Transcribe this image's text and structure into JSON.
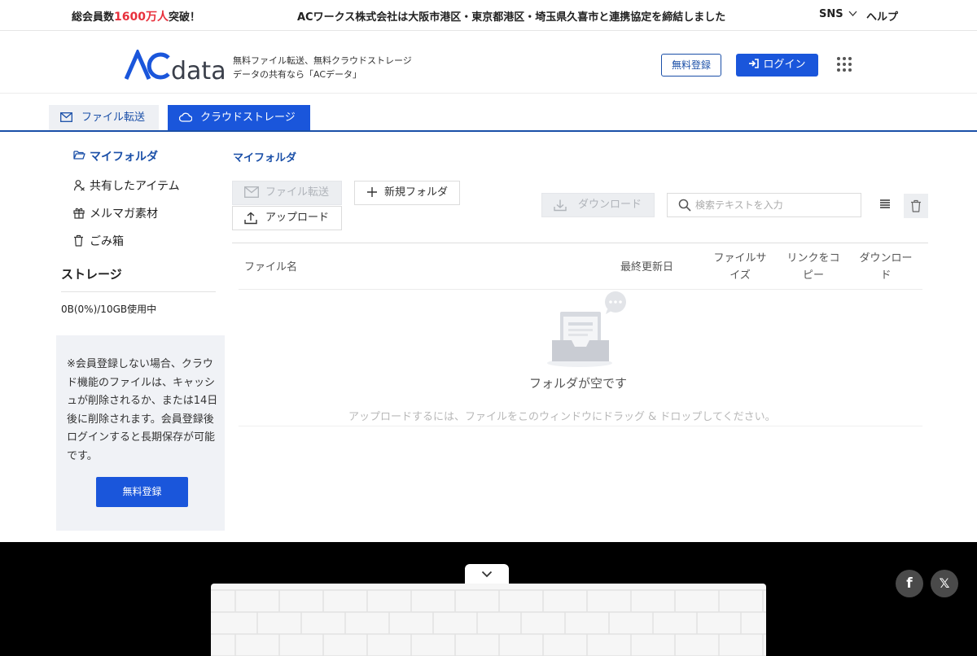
{
  "topbar": {
    "members_prefix": "総会員数",
    "members_count": "1600万人",
    "members_suffix": "突破！",
    "announcement": "ACワークス株式会社は大阪市港区・東京都港区・埼玉県久喜市と連携協定を締結しました",
    "sns_label": "SNS",
    "help_label": "ヘルプ"
  },
  "header": {
    "logo_text": "data",
    "tagline_line1": "無料ファイル転送、無料クラウドストレージ",
    "tagline_line2": "データの共有なら「ACデータ」",
    "register_label": "無料登録",
    "login_label": "ログイン"
  },
  "tabs": {
    "transfer_label": "ファイル転送",
    "cloud_label": "クラウドストレージ"
  },
  "sidebar": {
    "items": [
      {
        "label": "マイフォルダ"
      },
      {
        "label": "共有したアイテム"
      },
      {
        "label": "メルマガ素材"
      },
      {
        "label": "ごみ箱"
      }
    ],
    "storage_title": "ストレージ",
    "storage_usage": "0B(0%)/10GB使用中",
    "notice": "※会員登録しない場合、クラウド機能のファイルは、キャッシュが削除されるか、または14日後に削除されます。会員登録後ログインすると長期保存が可能です。",
    "register_label": "無料登録"
  },
  "main": {
    "breadcrumb": "マイフォルダ",
    "toolbar": {
      "transfer_label": "ファイル転送",
      "upload_label": "アップロード",
      "new_folder_label": "新規フォルダ",
      "download_label": "ダウンロード",
      "search_placeholder": "検索テキストを入力"
    },
    "columns": {
      "name": "ファイル名",
      "date": "最終更新日",
      "size_line1": "ファイルサ",
      "size_line2": "イズ",
      "link_line1": "リンクをコ",
      "link_line2": "ピー",
      "download_line1": "ダウンロー",
      "download_line2": "ド"
    },
    "empty_title": "フォルダが空です",
    "empty_hint": "アップロードするには、ファイルをこのウィンドウにドラッグ & ドロップしてください。"
  },
  "footer": {
    "facebook_label": "f",
    "x_label": "𝕏"
  },
  "colors": {
    "brand": "#1a56db",
    "brand_dark": "#1a4fa8",
    "highlight": "#e8303c"
  }
}
